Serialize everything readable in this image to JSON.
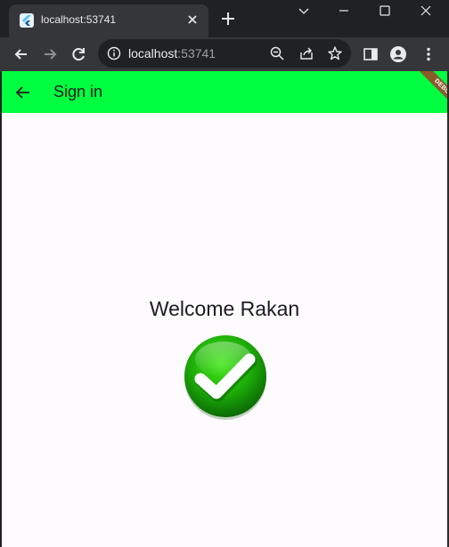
{
  "browser": {
    "tab": {
      "title": "localhost:53741"
    },
    "omnibox": {
      "host": "localhost",
      "port": ":53741"
    }
  },
  "app": {
    "appbar": {
      "title": "Sign in"
    },
    "debug_banner": "DEBUG",
    "welcome_text": "Welcome Rakan"
  },
  "colors": {
    "appbar_bg": "#00ff40",
    "check_green": "#22b80a",
    "page_bg": "#fdfbfe"
  },
  "icons": {
    "back": "arrow-left",
    "forward": "arrow-right",
    "reload": "reload",
    "info": "info-circle",
    "zoom": "zoom-out",
    "share": "share",
    "bookmark": "star",
    "sidebar": "side-panel",
    "profile": "person",
    "menu": "kebab",
    "success": "check-circle"
  }
}
